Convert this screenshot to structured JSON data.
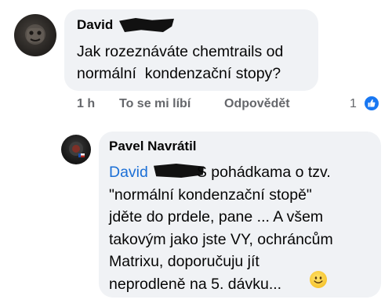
{
  "comment": {
    "author": "David",
    "text_line1": "Jak rozeznáváte chemtrails od",
    "text_line2": "normální  kondenzační stopy?",
    "time": "1 h",
    "like_label": "To se mi líbí",
    "reply_label": "Odpovědět",
    "reaction_count": "1"
  },
  "reply": {
    "author": "Pavel Navrátil",
    "mention": "David",
    "text_after_mention": "S pohádkama o tzv.",
    "lines": [
      "\"normální kondenzační stopě\"",
      "jděte do prdele, pane ... A všem",
      "takovým jako jste VY, ochráncům",
      "Matrixu, doporučuju jít",
      "neprodleně na 5. dávku..."
    ]
  },
  "icons": {
    "reaction": "thumbs-up-icon",
    "emoji": "smiling-face-icon"
  },
  "colors": {
    "bubble": "#f0f2f5",
    "mention": "#1b6fd6",
    "meta": "#65676b",
    "like_blue": "#1877f2"
  }
}
